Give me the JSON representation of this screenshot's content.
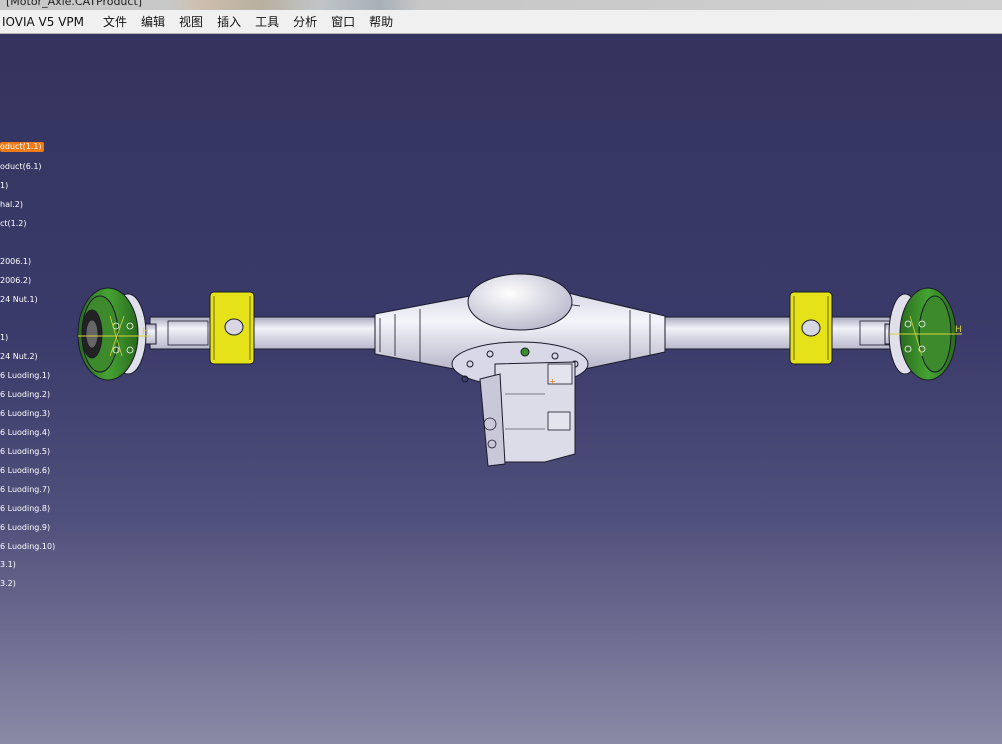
{
  "window": {
    "title": "[Motor_Axle.CATProduct]"
  },
  "menu": {
    "app_label": "IOVIA V5 VPM",
    "items": [
      "文件",
      "编辑",
      "视图",
      "插入",
      "工具",
      "分析",
      "窗口",
      "帮助"
    ]
  },
  "tree": {
    "items": [
      {
        "label": "oduct(1.1)",
        "selected": true
      },
      {
        "label": "oduct(6.1)",
        "selected": false
      },
      {
        "label": "1)",
        "selected": false
      },
      {
        "label": "hal.2)",
        "selected": false
      },
      {
        "label": "ct(1.2)",
        "selected": false
      },
      {
        "label": "2006.1)",
        "selected": false
      },
      {
        "label": "2006.2)",
        "selected": false
      },
      {
        "label": "24 Nut.1)",
        "selected": false
      },
      {
        "label": "1)",
        "selected": false
      },
      {
        "label": "24 Nut.2)",
        "selected": false
      },
      {
        "label": "6 Luoding.1)",
        "selected": false
      },
      {
        "label": "6 Luoding.2)",
        "selected": false
      },
      {
        "label": "6 Luoding.3)",
        "selected": false
      },
      {
        "label": "6 Luoding.4)",
        "selected": false
      },
      {
        "label": "6 Luoding.5)",
        "selected": false
      },
      {
        "label": "6 Luoding.6)",
        "selected": false
      },
      {
        "label": "6 Luoding.7)",
        "selected": false
      },
      {
        "label": "6 Luoding.8)",
        "selected": false
      },
      {
        "label": "6 Luoding.9)",
        "selected": false
      },
      {
        "label": "6 Luoding.10)",
        "selected": false
      },
      {
        "label": "3.1)",
        "selected": false
      },
      {
        "label": "3.2)",
        "selected": false
      }
    ]
  },
  "model": {
    "left_axis_label": "H",
    "right_axis_label": "H",
    "colors": {
      "wheel_green": "#3a8f2a",
      "bracket_yellow": "#e6e21a",
      "housing_white": "#e2e2ec",
      "outline": "#1a1a2a",
      "axis_yellow": "#d6d23a"
    }
  }
}
